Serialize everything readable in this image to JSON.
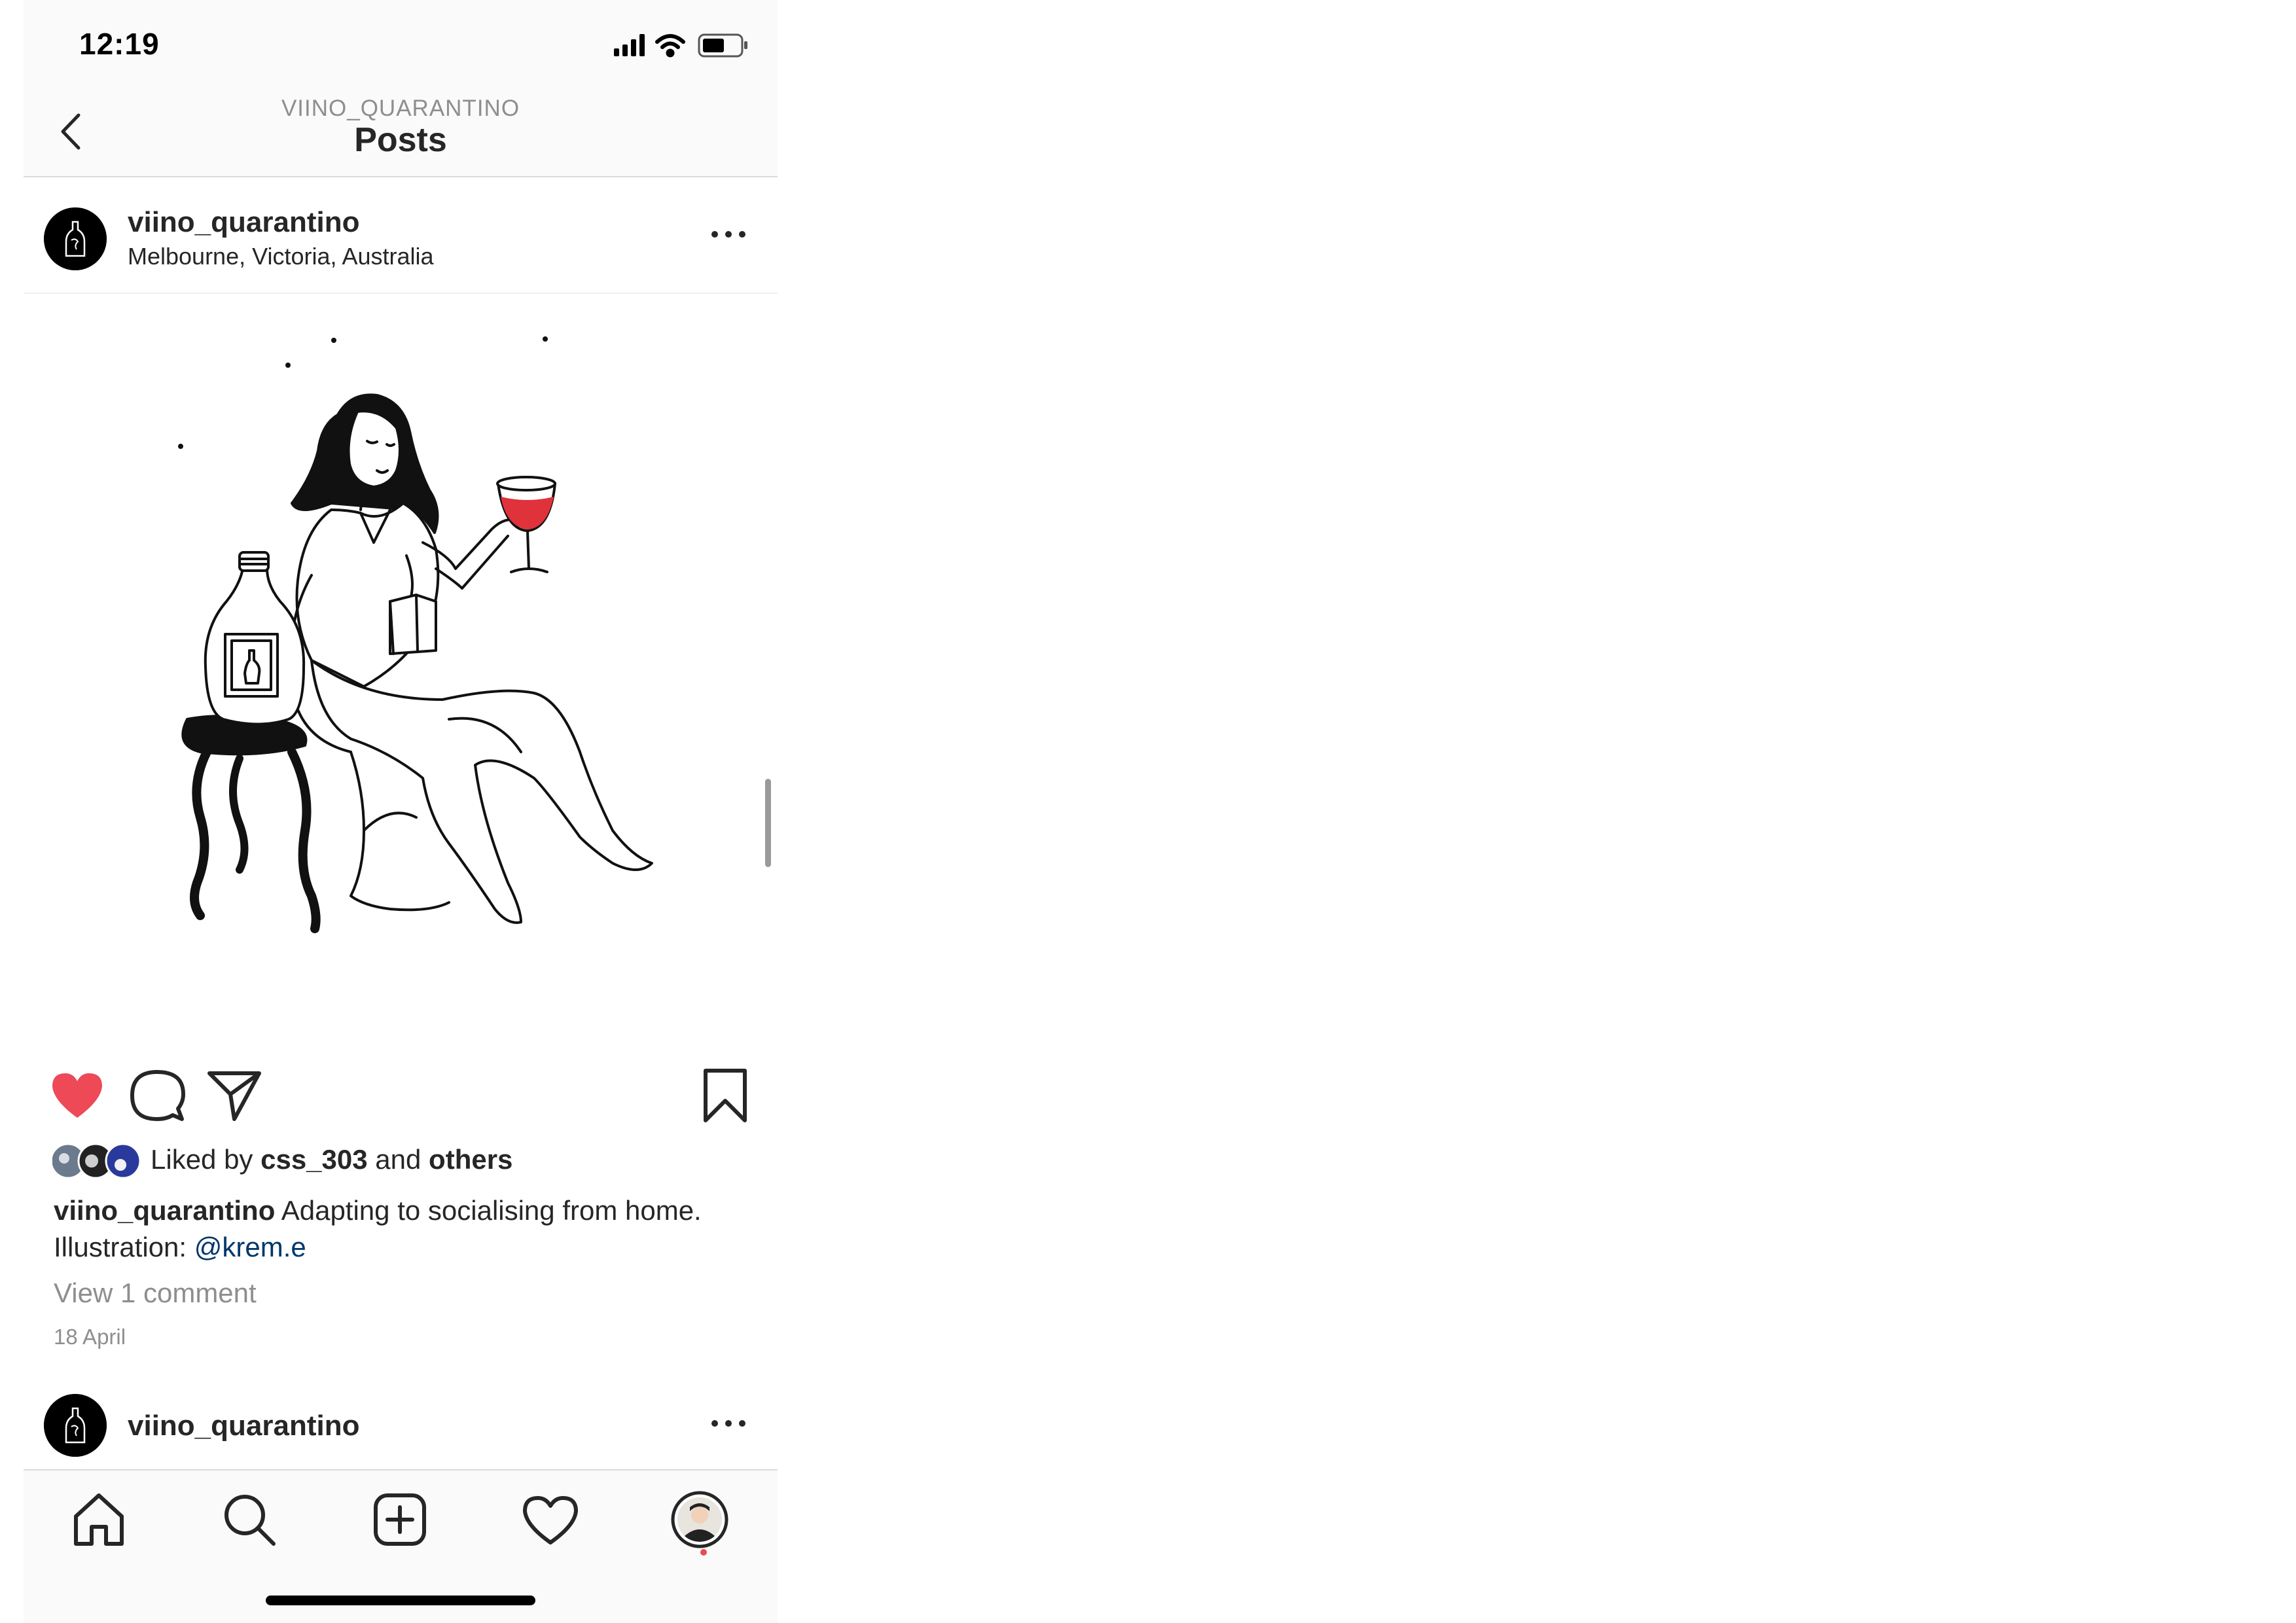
{
  "status_bar": {
    "time": "12:19"
  },
  "nav": {
    "subtitle": "VIINO_QUARANTINO",
    "title": "Posts"
  },
  "post": {
    "username": "viino_quarantino",
    "location": "Melbourne, Victoria, Australia",
    "liked_prefix": "Liked by",
    "liked_user": "css_303",
    "liked_and": "and",
    "liked_others": "others",
    "caption_user": "viino_quarantino",
    "caption_text": "Adapting to socialising from home.",
    "caption_line2": "Illustration:",
    "caption_mention": "@krem.e",
    "view_comments": "View 1 comment",
    "date": "18 April"
  },
  "next_post": {
    "username": "viino_quarantino"
  },
  "icons": {
    "back": "chevron-left-icon",
    "more": "more-horizontal-icon",
    "like": "heart-filled-icon",
    "comment": "comment-icon",
    "share": "paper-plane-icon",
    "save": "bookmark-icon",
    "tabs": [
      "home-icon",
      "search-icon",
      "add-post-icon",
      "activity-heart-icon",
      "profile-avatar-icon"
    ]
  },
  "colors": {
    "like": "#ed4956",
    "link": "#00376b",
    "secondary_text": "#8e8e8e",
    "wine": "#e0323a"
  }
}
